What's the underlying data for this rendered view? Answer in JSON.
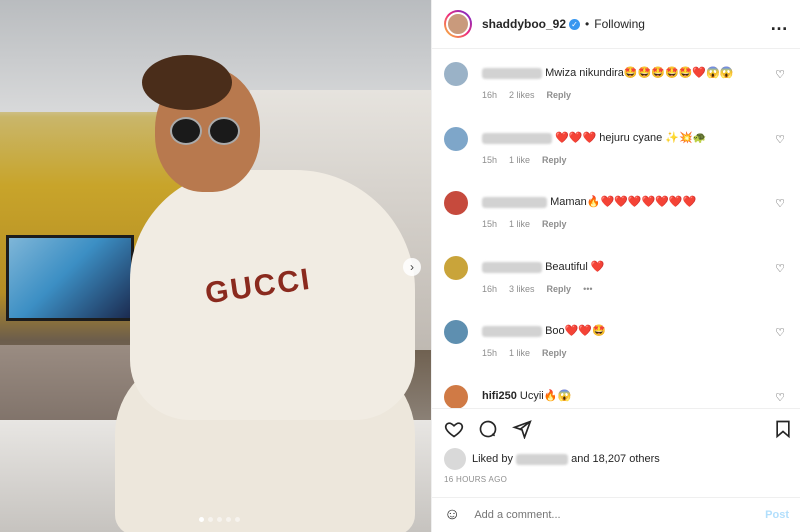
{
  "post": {
    "username": "shaddyboo_92",
    "verified_mark": "✓",
    "bullet": "•",
    "follow_status": "Following",
    "more_icon": "…"
  },
  "photo": {
    "print_text": "GUCCI",
    "nav_arrow": "›",
    "dots_count": 5,
    "active_dot": 0
  },
  "comments": [
    {
      "text": "Mwiza nikundira🤩🤩🤩🤩🤩❤️😱😱",
      "time": "16h",
      "likes": "2 likes",
      "reply": "Reply",
      "avatar_color": "#9ab2c7",
      "blur_w": 60,
      "prefix": ""
    },
    {
      "text": "❤️❤️❤️ hejuru cyane ✨💥🐢",
      "time": "15h",
      "likes": "1 like",
      "reply": "Reply",
      "avatar_color": "#7ea6c9",
      "blur_w": 70,
      "prefix": ""
    },
    {
      "text": "Maman🔥❤️❤️❤️❤️❤️❤️❤️",
      "time": "15h",
      "likes": "1 like",
      "reply": "Reply",
      "avatar_color": "#c64a3d",
      "blur_w": 65,
      "prefix": ""
    },
    {
      "text": "Beautiful ❤️",
      "time": "16h",
      "likes": "3 likes",
      "reply": "Reply",
      "avatar_color": "#c9a43a",
      "blur_w": 60,
      "prefix": "",
      "extra": "•••"
    },
    {
      "text": "Boo❤️❤️🤩",
      "time": "15h",
      "likes": "1 like",
      "reply": "Reply",
      "avatar_color": "#5e8fb0",
      "blur_w": 60,
      "prefix": ""
    },
    {
      "text": "Ucyii🔥😱",
      "time": "",
      "likes": "",
      "reply": "",
      "avatar_color": "#d07a45",
      "blur_w": 0,
      "prefix": "hifi250"
    }
  ],
  "likes_line": {
    "prefix": "Liked by",
    "middle": "and",
    "count": "18,207 others"
  },
  "timestamp": "16 HOURS AGO",
  "add_comment": {
    "placeholder": "Add a comment...",
    "post_label": "Post",
    "smile_icon": "☺"
  }
}
